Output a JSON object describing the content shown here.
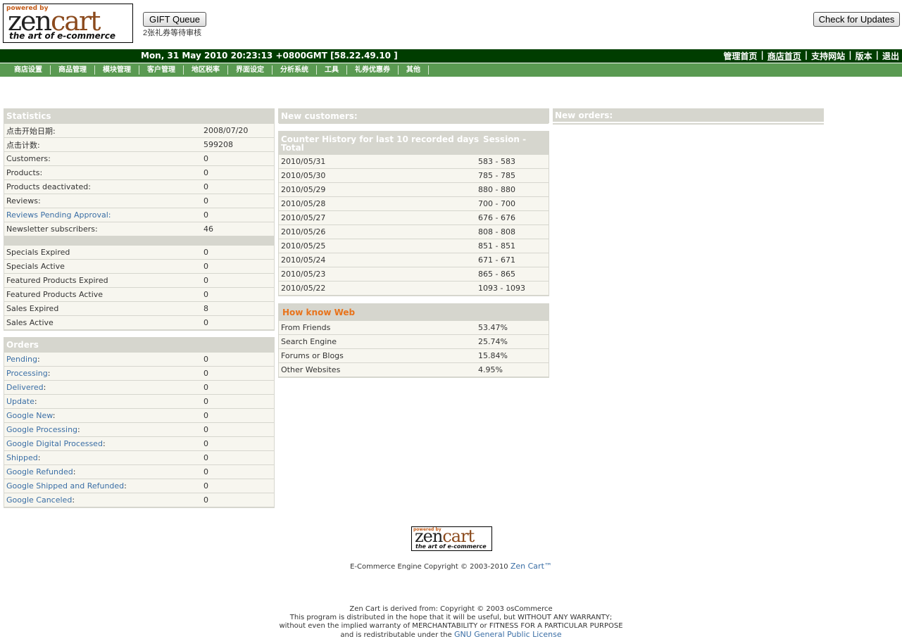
{
  "header": {
    "logo": {
      "powered_by": "powered by",
      "brand_zen": "zen",
      "brand_cart": "cart",
      "tagline": "the art of e-commerce"
    },
    "gift_queue_label": "GIFT Queue",
    "gift_queue_note": "2张礼券等待审核",
    "check_updates_label": "Check for Updates"
  },
  "topbar": {
    "datetime": "Mon, 31 May 2010 20:23:13 +0800GMT [58.22.49.10 ]",
    "links": [
      "管理首页",
      "商店首页",
      "支持网站",
      "版本",
      "退出"
    ]
  },
  "menu": [
    "商店设置",
    "商品管理",
    "模块管理",
    "客户管理",
    "地区税率",
    "界面设定",
    "分析系统",
    "工具",
    "礼券优惠券",
    "其他"
  ],
  "statistics": {
    "title": "Statistics",
    "rows": [
      {
        "label": "点击开始日期:",
        "value": "2008/07/20"
      },
      {
        "label": "点击计数:",
        "value": "599208"
      },
      {
        "label": "Customers:",
        "value": "0"
      },
      {
        "label": "Products:",
        "value": "0"
      },
      {
        "label": "Products deactivated:",
        "value": "0"
      },
      {
        "label": "Reviews:",
        "value": "0"
      },
      {
        "label": "Reviews Pending Approval:",
        "value": "0"
      },
      {
        "label": "Newsletter subscribers:",
        "value": "46"
      }
    ],
    "rows2": [
      {
        "label": "Specials Expired",
        "value": "0"
      },
      {
        "label": "Specials Active",
        "value": "0"
      },
      {
        "label": "Featured Products Expired",
        "value": "0"
      },
      {
        "label": "Featured Products Active",
        "value": "0"
      },
      {
        "label": "Sales Expired",
        "value": "8"
      },
      {
        "label": "Sales Active",
        "value": "0"
      }
    ]
  },
  "orders": {
    "title": "Orders",
    "rows": [
      {
        "label": "Pending",
        "value": "0"
      },
      {
        "label": "Processing",
        "value": "0"
      },
      {
        "label": "Delivered",
        "value": "0"
      },
      {
        "label": "Update",
        "value": "0"
      },
      {
        "label": "Google New",
        "value": "0"
      },
      {
        "label": "Google Processing",
        "value": "0"
      },
      {
        "label": "Google Digital Processed",
        "value": "0"
      },
      {
        "label": "Shipped",
        "value": "0"
      },
      {
        "label": "Google Refunded",
        "value": "0"
      },
      {
        "label": "Google Shipped and Refunded",
        "value": "0"
      },
      {
        "label": "Google Canceled",
        "value": "0"
      }
    ]
  },
  "new_customers": {
    "title": "New customers:"
  },
  "new_orders": {
    "title": "New orders:"
  },
  "counter": {
    "title": "Counter History for last 10 recorded days",
    "title_col2": "Session -",
    "title_line2": "Total",
    "rows": [
      {
        "date": "2010/05/31",
        "value": "583 - 583"
      },
      {
        "date": "2010/05/30",
        "value": "785 - 785"
      },
      {
        "date": "2010/05/29",
        "value": "880 - 880"
      },
      {
        "date": "2010/05/28",
        "value": "700 - 700"
      },
      {
        "date": "2010/05/27",
        "value": "676 - 676"
      },
      {
        "date": "2010/05/26",
        "value": "808 - 808"
      },
      {
        "date": "2010/05/25",
        "value": "851 - 851"
      },
      {
        "date": "2010/05/24",
        "value": "671 - 671"
      },
      {
        "date": "2010/05/23",
        "value": "865 - 865"
      },
      {
        "date": "2010/05/22",
        "value": "1093 - 1093"
      }
    ]
  },
  "howknow": {
    "title": "How know Web",
    "rows": [
      {
        "label": "From Friends",
        "value": "53.47%"
      },
      {
        "label": "Search Engine",
        "value": "25.74%"
      },
      {
        "label": "Forums or Blogs",
        "value": "15.84%"
      },
      {
        "label": "Other Websites",
        "value": "4.95%"
      }
    ]
  },
  "footer": {
    "copyright_text": "E-Commerce Engine Copyright © 2003-2010",
    "zencart_link": "Zen Cart™",
    "derived_1": "Zen Cart is derived from: Copyright © 2003 osCommerce",
    "derived_2": "This program is distributed in the hope that it will be useful, but WITHOUT ANY WARRANTY;",
    "derived_3": "without even the implied warranty of MERCHANTABILITY or FITNESS FOR A PARTICULAR PURPOSE",
    "derived_4": "and is redistributable under the",
    "gpl_link": "GNU General Public License"
  },
  "colors": {
    "dark_green": "#003d00",
    "menu_green": "#5a9a52",
    "panel_header": "#d6d6ce",
    "panel_bg": "#f7f6ef",
    "link": "#3a6ea5",
    "accent_orange": "#e8731b"
  }
}
